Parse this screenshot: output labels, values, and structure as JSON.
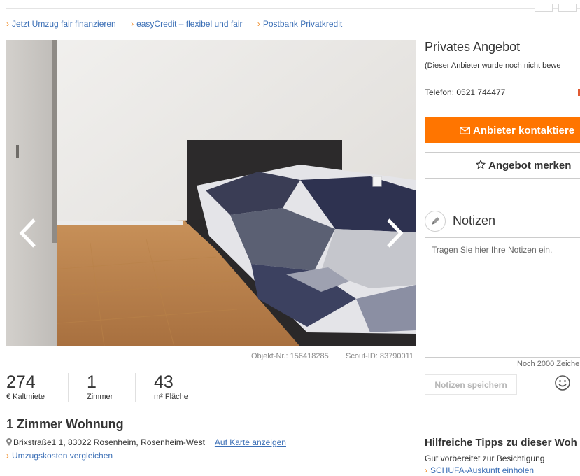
{
  "promo_links": [
    {
      "label": "Jetzt Umzug fair finanzieren"
    },
    {
      "label": "easyCredit – flexibel und fair"
    },
    {
      "label": "Postbank Privatkredit"
    }
  ],
  "listing": {
    "object_nr": "Objekt-Nr.: 156418285",
    "scout_id": "Scout-ID: 83790011",
    "stats": [
      {
        "value": "274",
        "label": "€ Kaltmiete"
      },
      {
        "value": "1",
        "label": "Zimmer"
      },
      {
        "value": "43",
        "label": "m² Fläche"
      }
    ],
    "title": "1 Zimmer Wohnung",
    "address": "Brixstraße1 1, 83022 Rosenheim, Rosenheim-West",
    "map_link": "Auf Karte anzeigen",
    "moving_costs_link": "Umzugskosten vergleichen"
  },
  "contact": {
    "offer_title": "Privates Angebot",
    "offer_subtitle": "(Dieser Anbieter wurde noch nicht bewe",
    "phone": "Telefon: 0521 744477",
    "contact_button": "Anbieter kontaktiere",
    "save_button": "Angebot merken"
  },
  "notes": {
    "heading": "Notizen",
    "placeholder": "Tragen Sie hier Ihre Notizen ein.",
    "remaining": "Noch 2000 Zeiche",
    "save_button": "Notizen speichern"
  },
  "tips": {
    "title": "Hilfreiche Tipps zu dieser Woh",
    "line": "Gut vorbereitet zur Besichtigung",
    "link": "SCHUFA-Auskunft einholen"
  },
  "colors": {
    "accent_orange": "#ff7500",
    "link_blue": "#3b6fb6"
  }
}
